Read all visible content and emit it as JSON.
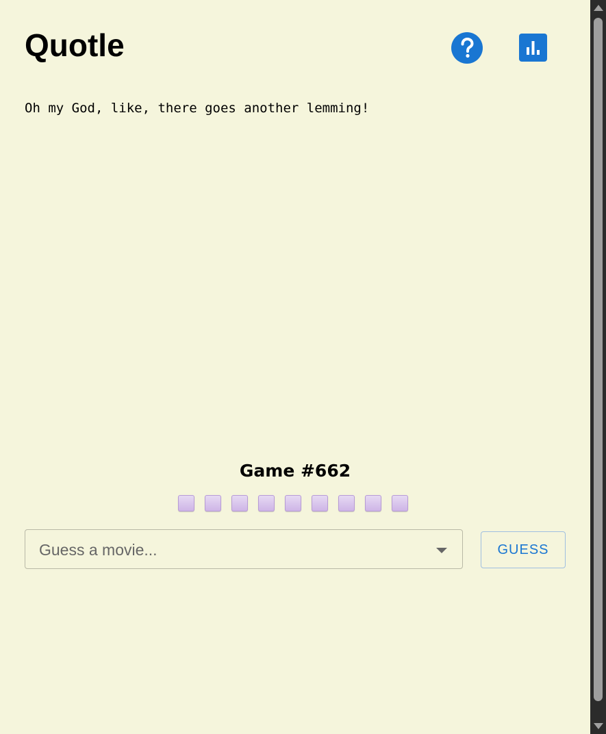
{
  "header": {
    "title": "Quotle",
    "help_icon": "question-mark-circle-icon",
    "stats_icon": "bar-chart-icon",
    "accent_color": "#1976d2"
  },
  "quote": {
    "text": "Oh my God, like, there goes another lemming!"
  },
  "game": {
    "label": "Game #662",
    "remaining_guesses": 9,
    "square_color": "#d6c0ec"
  },
  "guess_input": {
    "placeholder": "Guess a movie...",
    "value": ""
  },
  "guess_button": {
    "label": "GUESS"
  },
  "colors": {
    "background": "#f5f5dc",
    "scrollbar": "#2b2b2b"
  }
}
